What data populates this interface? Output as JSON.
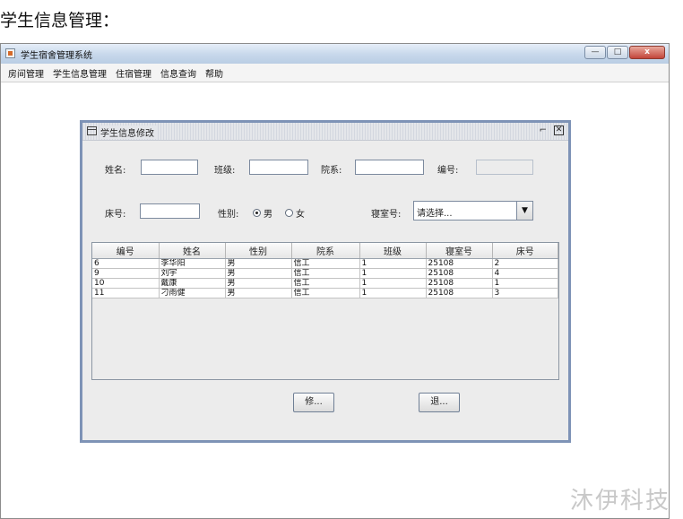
{
  "page": {
    "heading": "学生信息管理："
  },
  "window": {
    "title": "学生宿舍管理系统",
    "controls": {
      "minimize": "—",
      "maximize": "□",
      "close": "x"
    },
    "menu": [
      "房间管理",
      "学生信息管理",
      "住宿管理",
      "信息查询",
      "帮助"
    ]
  },
  "dialog": {
    "title": "学生信息修改",
    "restore_glyph": "⌐",
    "close_glyph": "✕",
    "form": {
      "name_label": "姓名:",
      "name_value": "",
      "class_label": "班级:",
      "class_value": "",
      "dept_label": "院系:",
      "dept_value": "",
      "id_label": "编号:",
      "id_value": "",
      "bed_label": "床号:",
      "bed_value": "",
      "gender_label": "性别:",
      "gender_male": "男",
      "gender_female": "女",
      "gender_selected": "男",
      "room_label": "寝室号:",
      "room_selected": "请选择...",
      "room_arrow": "▼"
    },
    "table": {
      "columns": [
        "编号",
        "姓名",
        "性别",
        "院系",
        "班级",
        "寝室号",
        "床号"
      ],
      "rows": [
        [
          "6",
          "李华阳",
          "男",
          "信工",
          "1",
          "25108",
          "2"
        ],
        [
          "9",
          "刘宇",
          "男",
          "信工",
          "1",
          "25108",
          "4"
        ],
        [
          "10",
          "戴康",
          "男",
          "信工",
          "1",
          "25108",
          "1"
        ],
        [
          "11",
          "刁雨健",
          "男",
          "信工",
          "1",
          "25108",
          "3"
        ]
      ]
    },
    "buttons": {
      "modify": "修...",
      "exit": "退..."
    }
  },
  "watermark": "沐伊科技"
}
